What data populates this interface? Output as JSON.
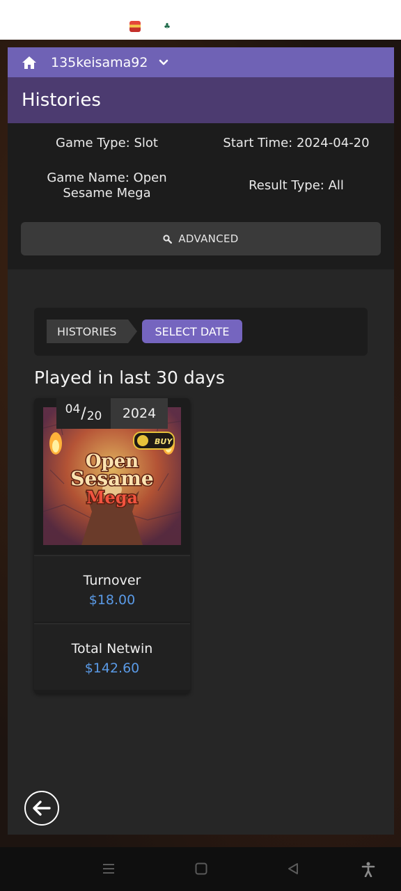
{
  "user": {
    "name": "135keisama92"
  },
  "page": {
    "title": "Histories"
  },
  "filters": {
    "game_type": "Game Type: Slot",
    "start_time": "Start Time: 2024-04-20",
    "game_name_line1": "Game Name: Open",
    "game_name_line2": "Sesame Mega",
    "result_type": "Result Type: All",
    "advanced_label": "ADVANCED"
  },
  "breadcrumb": {
    "histories": "HISTORIES",
    "select_date": "SELECT DATE"
  },
  "section": {
    "title": "Played in last 30 days"
  },
  "card": {
    "month": "04",
    "day": "20",
    "year": "2024",
    "game_art": {
      "line1": "Open",
      "line2": "Sesame",
      "line3": "Mega",
      "buy_badge": "BUY"
    },
    "turnover_label": "Turnover",
    "turnover_value": "$18.00",
    "netwin_label": "Total Netwin",
    "netwin_value": "$142.60"
  },
  "colors": {
    "topbar": "#6f62b5",
    "title_bar": "#4c3b70",
    "accent_button": "#7565bf",
    "value_blue": "#5a9ae6"
  },
  "icons": {
    "home": "home-icon",
    "chevron": "chevron-down-icon",
    "search": "search-icon",
    "back": "arrow-left-icon",
    "nav_menu": "menu-icon",
    "nav_home": "square-icon",
    "nav_back": "triangle-back-icon",
    "accessibility": "accessibility-icon"
  }
}
